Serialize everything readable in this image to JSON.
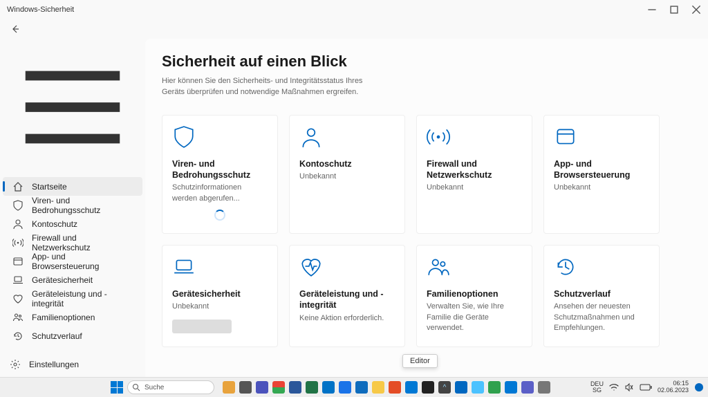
{
  "window": {
    "title": "Windows-Sicherheit"
  },
  "sidebar": {
    "items": [
      {
        "label": "Startseite"
      },
      {
        "label": "Viren- und Bedrohungsschutz"
      },
      {
        "label": "Kontoschutz"
      },
      {
        "label": "Firewall und Netzwerkschutz"
      },
      {
        "label": "App- und Browsersteuerung"
      },
      {
        "label": "Gerätesicherheit"
      },
      {
        "label": "Geräteleistung und -integrität"
      },
      {
        "label": "Familienoptionen"
      },
      {
        "label": "Schutzverlauf"
      }
    ],
    "settings": "Einstellungen"
  },
  "main": {
    "heading": "Sicherheit auf einen Blick",
    "subtitle": "Hier können Sie den Sicherheits- und Integritätsstatus Ihres Geräts überprüfen und notwendige Maßnahmen ergreifen."
  },
  "cards": [
    {
      "title": "Viren- und Bedrohungsschutz",
      "sub": "Schutzinformationen werden abgerufen..."
    },
    {
      "title": "Kontoschutz",
      "sub": "Unbekannt"
    },
    {
      "title": "Firewall und Netzwerkschutz",
      "sub": "Unbekannt"
    },
    {
      "title": "App- und Browsersteuerung",
      "sub": "Unbekannt"
    },
    {
      "title": "Gerätesicherheit",
      "sub": "Unbekannt"
    },
    {
      "title": "Geräteleistung und -integrität",
      "sub": "Keine Aktion erforderlich."
    },
    {
      "title": "Familienoptionen",
      "sub": "Verwalten Sie, wie Ihre Familie die Geräte verwendet."
    },
    {
      "title": "Schutzverlauf",
      "sub": "Ansehen der neuesten Schutzmaßnahmen und Empfehlungen."
    }
  ],
  "tooltip": "Editor",
  "taskbar": {
    "search_label": "Suche",
    "lang1": "DEU",
    "lang2": "SG",
    "time": "06:15",
    "date": "02.06.2023"
  }
}
